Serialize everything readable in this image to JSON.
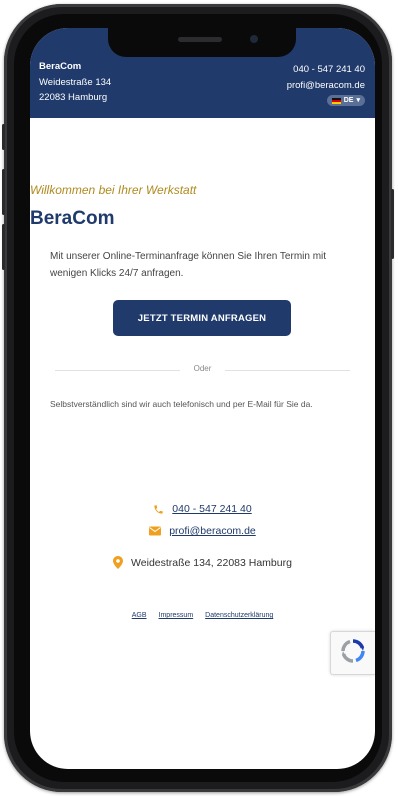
{
  "header": {
    "company": "BeraCom",
    "street": "Weidestraße 134",
    "city": "22083 Hamburg",
    "phone": "040 - 547 241 40",
    "email": "profi@beracom.de",
    "language": "DE",
    "background_color": "#1f3a6b"
  },
  "main": {
    "welcome": "Willkommen bei Ihrer Werkstatt",
    "title": "BeraCom",
    "intro": "Mit unserer Online-Terminanfrage können Sie Ihren Termin mit wenigen Klicks 24/7 anfragen.",
    "cta_label": "JETZT TERMIN ANFRAGEN",
    "divider_label": "Oder",
    "also_text": "Selbstverständlich sind wir auch telefonisch und per E-Mail für Sie da.",
    "phone": "040 - 547 241 40",
    "email": "profi@beracom.de",
    "address": "Weidestraße 134, 22083 Hamburg"
  },
  "footer": {
    "links": [
      "AGB",
      "Impressum",
      "Datenschutzerklärung"
    ]
  },
  "colors": {
    "brand_blue": "#1f3a6b",
    "accent_gold": "#b08a1f",
    "icon_orange": "#f0a020"
  },
  "icons": {
    "phone": "phone-icon",
    "mail": "mail-icon",
    "location": "location-pin-icon",
    "captcha": "recaptcha-icon"
  }
}
